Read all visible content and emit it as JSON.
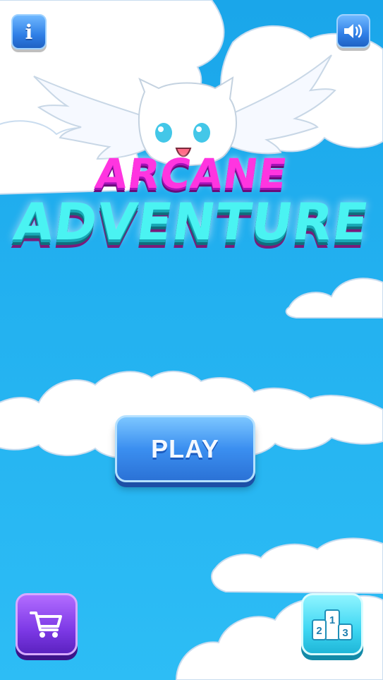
{
  "game": {
    "title_line1": "ARCANE",
    "title_line2": "ADVENTURE"
  },
  "buttons": {
    "info_label": "i",
    "play_label": "PLAY",
    "leaderboard_places": [
      "1",
      "2",
      "3"
    ]
  },
  "icons": {
    "info": "info-icon",
    "sound": "speaker-icon",
    "shop": "shopping-cart-icon",
    "leaderboard": "podium-icon",
    "mascot": "winged-cat-mascot"
  },
  "colors": {
    "sky": "#23b1f0",
    "title_pink": "#ff35e0",
    "title_cyan": "#4af3f2",
    "play_blue": "#3b8ff0",
    "shop_purple": "#7d39e6",
    "rank_cyan": "#3dd6f2"
  }
}
